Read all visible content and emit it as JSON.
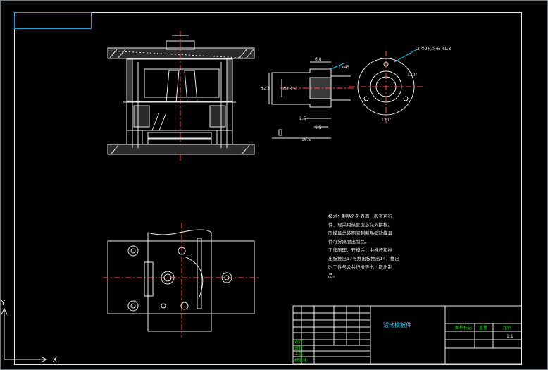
{
  "drawing": {
    "view_section_dims": {
      "d_outer": "Φ4.8",
      "d_inner": "Φ13.5",
      "d_top": "6.8",
      "d_left": "2.5",
      "d_bottom": "16.5",
      "d_mid": "1.5",
      "taper": "1×45"
    },
    "view_end_dims": {
      "note": "3-Φ2孔均布 R1.8",
      "angle_right": "120°",
      "angle_bottom": "120°"
    },
    "tech_requirements": [
      "技术：制品外外表面一般有可行",
      "件，现采用热套型芯交入拼模。",
      "同模具总装图阅制制品缩放模具",
      "件可分离脱出制品。",
      "工作原理：开模后，由推杆和推",
      "出板推出17号推出板推出14，推出",
      "时工件与公共行推等出，取出制",
      "品。"
    ],
    "title_block": {
      "title": "活动模板件",
      "code_label": "图样标记",
      "scale_header": "比例",
      "scale_value": "1:1",
      "mass_header": "重量",
      "rows": [
        "设计",
        "审核",
        "工艺",
        "标准化"
      ]
    },
    "ucs": {
      "x": "X",
      "y": "Y"
    }
  }
}
